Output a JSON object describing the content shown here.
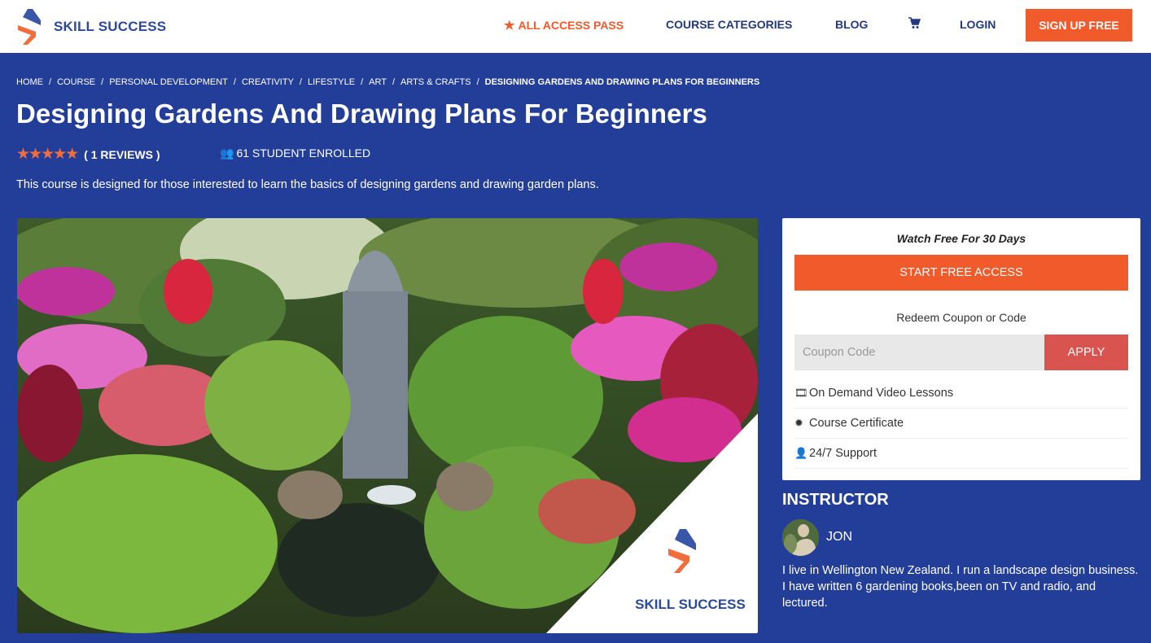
{
  "brand": {
    "name": "SKILL SUCCESS",
    "primary": "#233e99",
    "accent": "#f15a2b",
    "apply": "#d9534f"
  },
  "nav": {
    "all_access": "ALL ACCESS PASS",
    "all_access_icon": "star-icon",
    "categories": "COURSE CATEGORIES",
    "blog": "BLOG",
    "cart_icon": "cart-icon",
    "login": "LOGIN",
    "signup": "SIGN UP FREE"
  },
  "breadcrumb": [
    "HOME",
    "COURSE",
    "PERSONAL DEVELOPMENT",
    "CREATIVITY",
    "LIFESTYLE",
    "ART",
    "ARTS & CRAFTS"
  ],
  "breadcrumb_current": "DESIGNING GARDENS AND DRAWING PLANS FOR BEGINNERS",
  "course": {
    "title": "Designing Gardens And Drawing Plans For Beginners",
    "rating": 5,
    "rating_max": 5,
    "stars": "★★★★★",
    "reviews": "( 1 REVIEWS )",
    "enrolled": "61 STUDENT ENROLLED",
    "description": "This course is designed for those interested to learn the basics of designing gardens and drawing garden plans.",
    "image_alt": "Garden with colorful plants and waterfall",
    "image_brand": "SKILL SUCCESS"
  },
  "card": {
    "watch": "Watch Free For 30 Days",
    "start": "START FREE ACCESS",
    "redeem": "Redeem Coupon or Code",
    "coupon_placeholder": "Coupon Code",
    "apply": "APPLY",
    "features": [
      {
        "icon": "film-icon",
        "label": "On Demand Video Lessons"
      },
      {
        "icon": "certificate-icon",
        "label": "Course Certificate"
      },
      {
        "icon": "support-icon",
        "label": "24/7 Support"
      }
    ]
  },
  "instructor": {
    "heading": "INSTRUCTOR",
    "name": "JON",
    "bio": "I live in Wellington New Zealand. I run a landscape design business. I have written 6 gardening books,been on TV and radio, and lectured."
  }
}
